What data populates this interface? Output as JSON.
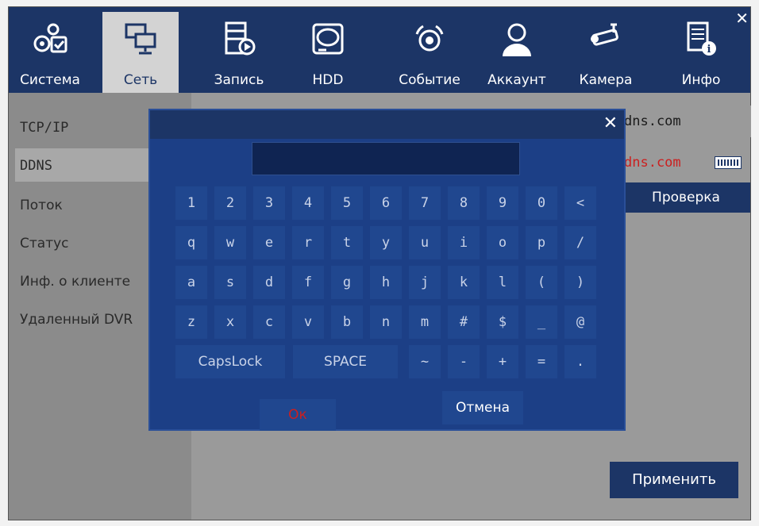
{
  "tabs": [
    {
      "label": "Система",
      "icon": "gears-check-icon"
    },
    {
      "label": "Сеть",
      "icon": "network-monitors-icon",
      "active": true
    },
    {
      "label": "Запись",
      "icon": "film-record-icon"
    },
    {
      "label": "HDD",
      "icon": "hard-drive-icon"
    },
    {
      "label": "Событие",
      "icon": "alarm-bell-icon"
    },
    {
      "label": "Аккаунт",
      "icon": "user-account-icon"
    },
    {
      "label": "Камера",
      "icon": "security-camera-icon"
    },
    {
      "label": "Инфо",
      "icon": "info-document-icon"
    }
  ],
  "nav": [
    "TCP/IP",
    "DDNS",
    "Поток",
    "Статус",
    "Инф. о клиенте",
    "Удаленный DVR"
  ],
  "nav_selected": "DDNS",
  "host_field_1": "dns.com",
  "host_field_2": "dns.com",
  "verify_label": "Проверка",
  "apply_label": "Применить",
  "keyboard": {
    "input_value": "",
    "rows": [
      [
        "1",
        "2",
        "3",
        "4",
        "5",
        "6",
        "7",
        "8",
        "9",
        "0",
        "<"
      ],
      [
        "q",
        "w",
        "e",
        "r",
        "t",
        "y",
        "u",
        "i",
        "o",
        "p",
        "/"
      ],
      [
        "a",
        "s",
        "d",
        "f",
        "g",
        "h",
        "j",
        "k",
        "l",
        "(",
        ")"
      ],
      [
        "z",
        "x",
        "c",
        "v",
        "b",
        "n",
        "m",
        "#",
        "$",
        "_",
        "@"
      ]
    ],
    "bottom_row": [
      "CapsLock",
      "SPACE",
      "~",
      "-",
      "+",
      "=",
      "."
    ],
    "ok_label": "Ок",
    "cancel_label": "Отмена"
  },
  "colors": {
    "header": "#1c3566",
    "dialog": "#1c3f86",
    "key": "#20478f",
    "ok_text": "#cc1f1f",
    "host_text_2": "#cc1f1f"
  }
}
